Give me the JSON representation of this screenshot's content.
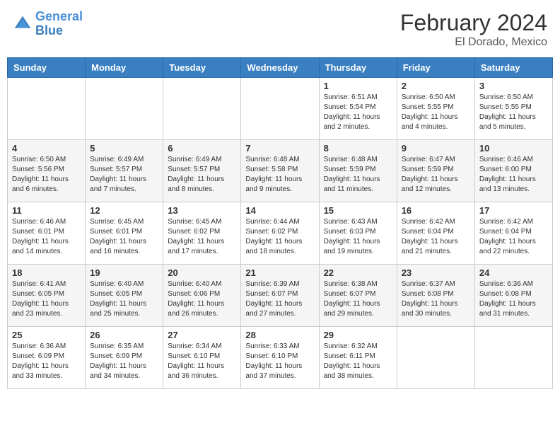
{
  "header": {
    "logo_line1": "General",
    "logo_line2": "Blue",
    "month_title": "February 2024",
    "location": "El Dorado, Mexico"
  },
  "days_of_week": [
    "Sunday",
    "Monday",
    "Tuesday",
    "Wednesday",
    "Thursday",
    "Friday",
    "Saturday"
  ],
  "weeks": [
    [
      {
        "day": "",
        "info": ""
      },
      {
        "day": "",
        "info": ""
      },
      {
        "day": "",
        "info": ""
      },
      {
        "day": "",
        "info": ""
      },
      {
        "day": "1",
        "info": "Sunrise: 6:51 AM\nSunset: 5:54 PM\nDaylight: 11 hours and 2 minutes."
      },
      {
        "day": "2",
        "info": "Sunrise: 6:50 AM\nSunset: 5:55 PM\nDaylight: 11 hours and 4 minutes."
      },
      {
        "day": "3",
        "info": "Sunrise: 6:50 AM\nSunset: 5:55 PM\nDaylight: 11 hours and 5 minutes."
      }
    ],
    [
      {
        "day": "4",
        "info": "Sunrise: 6:50 AM\nSunset: 5:56 PM\nDaylight: 11 hours and 6 minutes."
      },
      {
        "day": "5",
        "info": "Sunrise: 6:49 AM\nSunset: 5:57 PM\nDaylight: 11 hours and 7 minutes."
      },
      {
        "day": "6",
        "info": "Sunrise: 6:49 AM\nSunset: 5:57 PM\nDaylight: 11 hours and 8 minutes."
      },
      {
        "day": "7",
        "info": "Sunrise: 6:48 AM\nSunset: 5:58 PM\nDaylight: 11 hours and 9 minutes."
      },
      {
        "day": "8",
        "info": "Sunrise: 6:48 AM\nSunset: 5:59 PM\nDaylight: 11 hours and 11 minutes."
      },
      {
        "day": "9",
        "info": "Sunrise: 6:47 AM\nSunset: 5:59 PM\nDaylight: 11 hours and 12 minutes."
      },
      {
        "day": "10",
        "info": "Sunrise: 6:46 AM\nSunset: 6:00 PM\nDaylight: 11 hours and 13 minutes."
      }
    ],
    [
      {
        "day": "11",
        "info": "Sunrise: 6:46 AM\nSunset: 6:01 PM\nDaylight: 11 hours and 14 minutes."
      },
      {
        "day": "12",
        "info": "Sunrise: 6:45 AM\nSunset: 6:01 PM\nDaylight: 11 hours and 16 minutes."
      },
      {
        "day": "13",
        "info": "Sunrise: 6:45 AM\nSunset: 6:02 PM\nDaylight: 11 hours and 17 minutes."
      },
      {
        "day": "14",
        "info": "Sunrise: 6:44 AM\nSunset: 6:02 PM\nDaylight: 11 hours and 18 minutes."
      },
      {
        "day": "15",
        "info": "Sunrise: 6:43 AM\nSunset: 6:03 PM\nDaylight: 11 hours and 19 minutes."
      },
      {
        "day": "16",
        "info": "Sunrise: 6:42 AM\nSunset: 6:04 PM\nDaylight: 11 hours and 21 minutes."
      },
      {
        "day": "17",
        "info": "Sunrise: 6:42 AM\nSunset: 6:04 PM\nDaylight: 11 hours and 22 minutes."
      }
    ],
    [
      {
        "day": "18",
        "info": "Sunrise: 6:41 AM\nSunset: 6:05 PM\nDaylight: 11 hours and 23 minutes."
      },
      {
        "day": "19",
        "info": "Sunrise: 6:40 AM\nSunset: 6:05 PM\nDaylight: 11 hours and 25 minutes."
      },
      {
        "day": "20",
        "info": "Sunrise: 6:40 AM\nSunset: 6:06 PM\nDaylight: 11 hours and 26 minutes."
      },
      {
        "day": "21",
        "info": "Sunrise: 6:39 AM\nSunset: 6:07 PM\nDaylight: 11 hours and 27 minutes."
      },
      {
        "day": "22",
        "info": "Sunrise: 6:38 AM\nSunset: 6:07 PM\nDaylight: 11 hours and 29 minutes."
      },
      {
        "day": "23",
        "info": "Sunrise: 6:37 AM\nSunset: 6:08 PM\nDaylight: 11 hours and 30 minutes."
      },
      {
        "day": "24",
        "info": "Sunrise: 6:36 AM\nSunset: 6:08 PM\nDaylight: 11 hours and 31 minutes."
      }
    ],
    [
      {
        "day": "25",
        "info": "Sunrise: 6:36 AM\nSunset: 6:09 PM\nDaylight: 11 hours and 33 minutes."
      },
      {
        "day": "26",
        "info": "Sunrise: 6:35 AM\nSunset: 6:09 PM\nDaylight: 11 hours and 34 minutes."
      },
      {
        "day": "27",
        "info": "Sunrise: 6:34 AM\nSunset: 6:10 PM\nDaylight: 11 hours and 36 minutes."
      },
      {
        "day": "28",
        "info": "Sunrise: 6:33 AM\nSunset: 6:10 PM\nDaylight: 11 hours and 37 minutes."
      },
      {
        "day": "29",
        "info": "Sunrise: 6:32 AM\nSunset: 6:11 PM\nDaylight: 11 hours and 38 minutes."
      },
      {
        "day": "",
        "info": ""
      },
      {
        "day": "",
        "info": ""
      }
    ]
  ]
}
